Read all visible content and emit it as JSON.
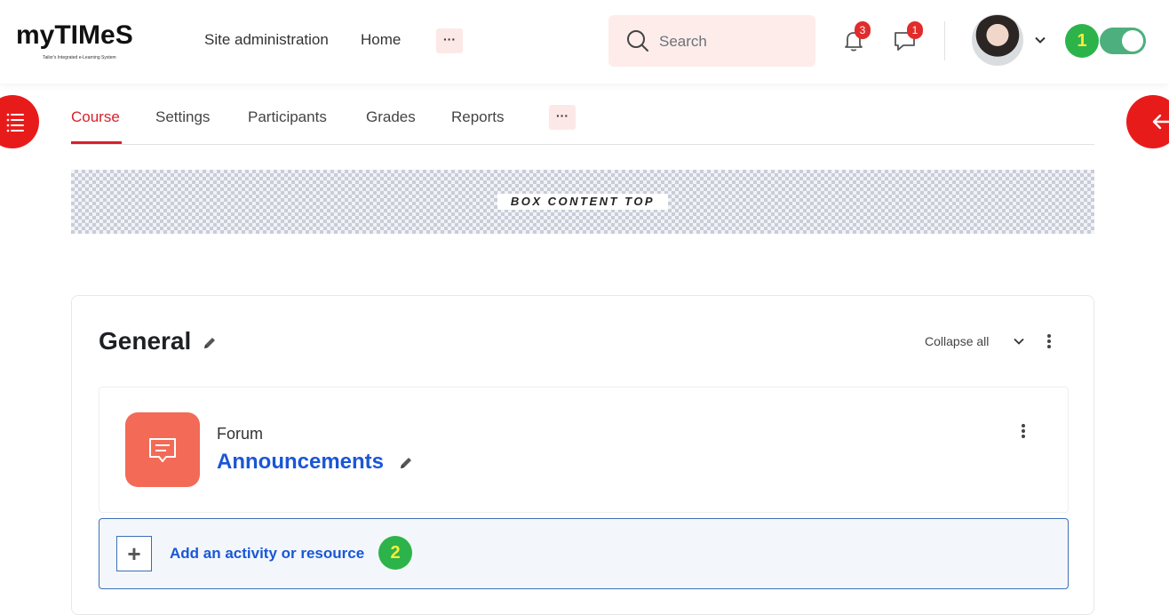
{
  "brand": {
    "logo_text": "myTIMeS",
    "logo_subtitle": "Tailor's Integrated e-Learning System"
  },
  "topnav": {
    "items": [
      {
        "label": "Site administration"
      },
      {
        "label": "Home"
      }
    ],
    "more_label": "···"
  },
  "search": {
    "placeholder": "Search"
  },
  "notifications": {
    "count": "3"
  },
  "messages": {
    "count": "1"
  },
  "markers": {
    "one": "1",
    "two": "2"
  },
  "tabs": [
    {
      "label": "Course",
      "active": true
    },
    {
      "label": "Settings"
    },
    {
      "label": "Participants"
    },
    {
      "label": "Grades"
    },
    {
      "label": "Reports"
    }
  ],
  "tabs_more_label": "···",
  "box_content_top": "BOX CONTENT TOP",
  "section": {
    "title": "General",
    "collapse_label": "Collapse all"
  },
  "activity": {
    "type": "Forum",
    "name": "Announcements"
  },
  "add_activity": {
    "plus": "+",
    "label": "Add an activity or resource"
  },
  "colors": {
    "accent": "#d8212c",
    "side_buttons": "#e81b1b",
    "link": "#1a56d6",
    "forum_icon_bg": "#f36a57",
    "marker_bg": "#2cb34a",
    "marker_text": "#ffeb3b",
    "toggle_on": "#4caf7d"
  },
  "icons": {
    "drawer_left": "list-icon",
    "drawer_right": "arrow-left-icon",
    "search": "search-icon",
    "notifications": "bell-icon",
    "messages": "chat-icon",
    "edit": "pencil-icon",
    "forum": "forum-icon"
  }
}
